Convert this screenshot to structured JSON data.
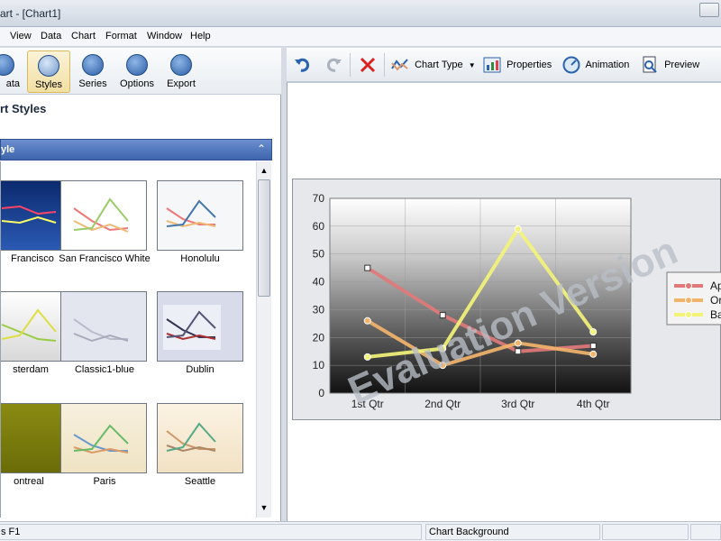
{
  "window": {
    "title": "art - [Chart1]"
  },
  "menu": [
    "View",
    "Data",
    "Chart",
    "Format",
    "Window",
    "Help"
  ],
  "left_toolbar": {
    "buttons": [
      {
        "label": "ata",
        "icon": "data-icon"
      },
      {
        "label": "Styles",
        "icon": "styles-icon"
      },
      {
        "label": "Series",
        "icon": "series-icon"
      },
      {
        "label": "Options",
        "icon": "options-icon"
      },
      {
        "label": "Export",
        "icon": "export-icon"
      }
    ]
  },
  "styles_panel": {
    "heading": "rt Styles",
    "group_label": "yle",
    "thumbnails": [
      {
        "caption": "Francisco"
      },
      {
        "caption": "San Francisco White"
      },
      {
        "caption": "Honolulu"
      },
      {
        "caption": "sterdam"
      },
      {
        "caption": "Classic1-blue"
      },
      {
        "caption": "Dublin"
      },
      {
        "caption": "ontreal"
      },
      {
        "caption": "Paris"
      },
      {
        "caption": "Seattle"
      }
    ]
  },
  "right_toolbar": {
    "undo_icon": "undo-icon",
    "redo_icon": "redo-icon",
    "delete_icon": "delete-icon",
    "chart_type": "Chart Type",
    "properties": "Properties",
    "animation": "Animation",
    "preview": "Preview"
  },
  "watermark": "Evaluation Version",
  "status": {
    "help": "s F1",
    "selection": "Chart Background"
  },
  "colors": {
    "apples": "#e07a7a",
    "oranges": "#f2b36b",
    "bananas": "#f3f37a",
    "accent": "#3e64ad"
  },
  "chart_data": {
    "type": "line",
    "categories": [
      "1st Qtr",
      "2nd Qtr",
      "3rd Qtr",
      "4th Qtr"
    ],
    "ylim": [
      0,
      70
    ],
    "yticks": [
      0,
      10,
      20,
      30,
      40,
      50,
      60,
      70
    ],
    "series": [
      {
        "name": "Ap",
        "values": [
          45,
          28,
          15,
          17
        ]
      },
      {
        "name": "Or",
        "values": [
          26,
          10,
          18,
          14
        ]
      },
      {
        "name": "Ba",
        "values": [
          13,
          16,
          59,
          22
        ]
      }
    ],
    "legend": "right"
  }
}
